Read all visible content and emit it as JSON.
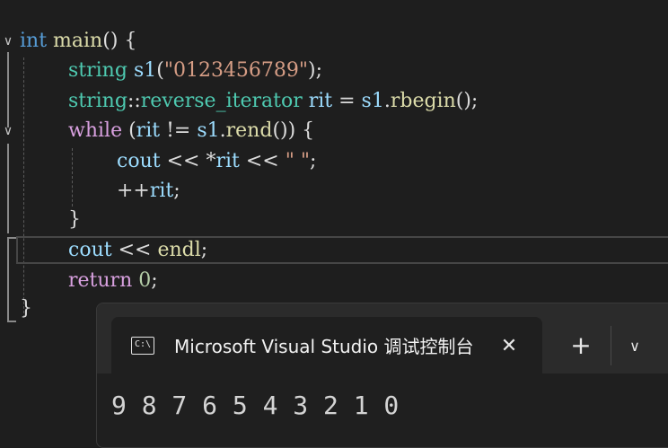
{
  "editor": {
    "lines": [
      [
        {
          "t": "int",
          "c": "kw"
        },
        {
          "t": " ",
          "c": "plain"
        },
        {
          "t": "main",
          "c": "fn"
        },
        {
          "t": "() {",
          "c": "plain"
        }
      ],
      [
        {
          "t": "string",
          "c": "ty"
        },
        {
          "t": " ",
          "c": "plain"
        },
        {
          "t": "s1",
          "c": "var"
        },
        {
          "t": "(",
          "c": "plain"
        },
        {
          "t": "\"0123456789\"",
          "c": "str"
        },
        {
          "t": ");",
          "c": "plain"
        }
      ],
      [
        {
          "t": "string",
          "c": "ty"
        },
        {
          "t": "::",
          "c": "plain"
        },
        {
          "t": "reverse_iterator",
          "c": "ty"
        },
        {
          "t": " ",
          "c": "plain"
        },
        {
          "t": "rit",
          "c": "var"
        },
        {
          "t": " = ",
          "c": "plain"
        },
        {
          "t": "s1",
          "c": "var"
        },
        {
          "t": ".",
          "c": "plain"
        },
        {
          "t": "rbegin",
          "c": "fn"
        },
        {
          "t": "();",
          "c": "plain"
        }
      ],
      [
        {
          "t": "while",
          "c": "ctl"
        },
        {
          "t": " (",
          "c": "plain"
        },
        {
          "t": "rit",
          "c": "var"
        },
        {
          "t": " != ",
          "c": "plain"
        },
        {
          "t": "s1",
          "c": "var"
        },
        {
          "t": ".",
          "c": "plain"
        },
        {
          "t": "rend",
          "c": "fn"
        },
        {
          "t": "()) {",
          "c": "plain"
        }
      ],
      [
        {
          "t": "cout",
          "c": "var"
        },
        {
          "t": " << ",
          "c": "plain"
        },
        {
          "t": "*",
          "c": "plain"
        },
        {
          "t": "rit",
          "c": "var"
        },
        {
          "t": " << ",
          "c": "plain"
        },
        {
          "t": "\" \"",
          "c": "str"
        },
        {
          "t": ";",
          "c": "plain"
        }
      ],
      [
        {
          "t": "++",
          "c": "plain"
        },
        {
          "t": "rit",
          "c": "var"
        },
        {
          "t": ";",
          "c": "plain"
        }
      ],
      [
        {
          "t": "}",
          "c": "plain"
        }
      ],
      [
        {
          "t": "cout",
          "c": "var"
        },
        {
          "t": " << ",
          "c": "plain"
        },
        {
          "t": "endl",
          "c": "fn"
        },
        {
          "t": ";",
          "c": "plain"
        }
      ],
      [
        {
          "t": "return",
          "c": "ctl"
        },
        {
          "t": " ",
          "c": "plain"
        },
        {
          "t": "0",
          "c": "num"
        },
        {
          "t": ";",
          "c": "plain"
        }
      ],
      [
        {
          "t": "}",
          "c": "plain"
        }
      ]
    ],
    "fold_icon": "chevron-down-icon"
  },
  "terminal": {
    "tab_icon_glyph": "C:\\",
    "tab_icon": "terminal-icon",
    "tab_title": "Microsoft Visual Studio 调试控制台",
    "close_glyph": "✕",
    "new_tab_glyph": "+",
    "dropdown_glyph": "∨",
    "output": "9 8 7 6 5 4 3 2 1 0"
  }
}
